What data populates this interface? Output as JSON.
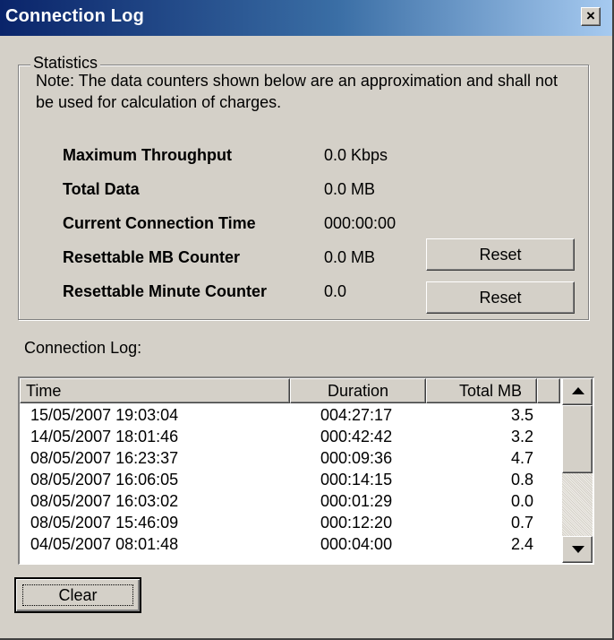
{
  "window": {
    "title": "Connection Log",
    "close_label": "×"
  },
  "statistics": {
    "legend": "Statistics",
    "note": "Note: The data counters shown below are an approximation and shall not be used for calculation of charges.",
    "rows": [
      {
        "label": "Maximum Throughput",
        "value": "0.0 Kbps"
      },
      {
        "label": "Total Data",
        "value": "0.0 MB"
      },
      {
        "label": "Current Connection Time",
        "value": "000:00:00"
      },
      {
        "label": "Resettable MB Counter",
        "value": "0.0 MB"
      },
      {
        "label": "Resettable Minute Counter",
        "value": "0.0"
      }
    ],
    "reset_label": "Reset"
  },
  "log": {
    "label": "Connection Log:",
    "columns": [
      "Time",
      "Duration",
      "Total MB"
    ],
    "rows": [
      {
        "time": "15/05/2007 19:03:04",
        "duration": "004:27:17",
        "total": "3.5"
      },
      {
        "time": "14/05/2007 18:01:46",
        "duration": "000:42:42",
        "total": "3.2"
      },
      {
        "time": "08/05/2007 16:23:37",
        "duration": "000:09:36",
        "total": "4.7"
      },
      {
        "time": "08/05/2007 16:06:05",
        "duration": "000:14:15",
        "total": "0.8"
      },
      {
        "time": "08/05/2007 16:03:02",
        "duration": "000:01:29",
        "total": "0.0"
      },
      {
        "time": "08/05/2007 15:46:09",
        "duration": "000:12:20",
        "total": "0.7"
      },
      {
        "time": "04/05/2007 08:01:48",
        "duration": "000:04:00",
        "total": "2.4"
      }
    ]
  },
  "actions": {
    "clear_label": "Clear"
  },
  "colors": {
    "titlebar_start": "#0a246a",
    "titlebar_end": "#a6caf0",
    "face": "#d4d0c8"
  },
  "icons": {
    "close": "close-icon",
    "scroll_up": "arrow-up-icon",
    "scroll_down": "arrow-down-icon"
  }
}
